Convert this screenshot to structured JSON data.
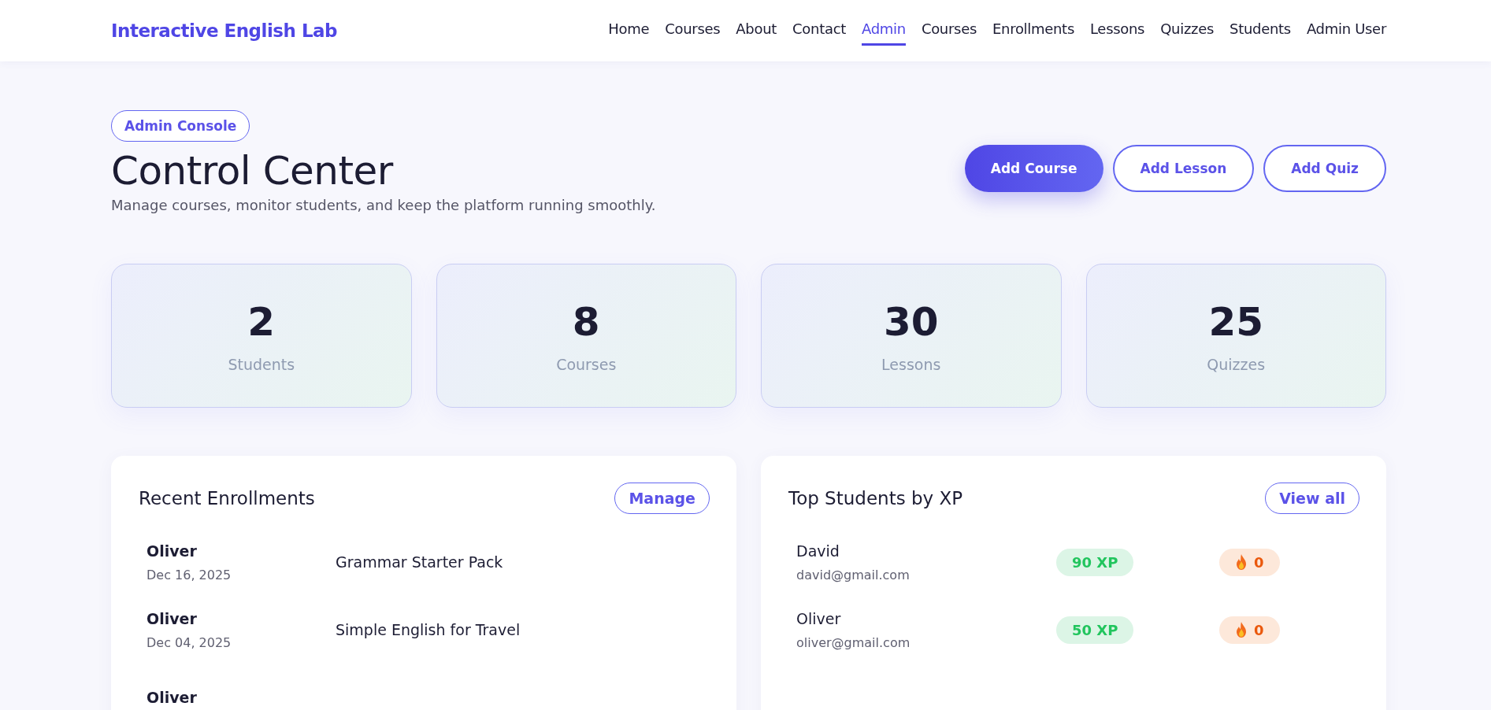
{
  "brand": "Interactive English Lab",
  "nav": [
    {
      "label": "Home",
      "selected": false
    },
    {
      "label": "Courses",
      "selected": false
    },
    {
      "label": "About",
      "selected": false
    },
    {
      "label": "Contact",
      "selected": false
    },
    {
      "label": "Admin",
      "selected": true
    },
    {
      "label": "Courses",
      "selected": false
    },
    {
      "label": "Enrollments",
      "selected": false
    },
    {
      "label": "Lessons",
      "selected": false
    },
    {
      "label": "Quizzes",
      "selected": false
    },
    {
      "label": "Students",
      "selected": false
    },
    {
      "label": "Admin User",
      "selected": false
    }
  ],
  "badge": "Admin Console",
  "title": "Control Center",
  "subtitle": "Manage courses, monitor students, and keep the platform running smoothly.",
  "actions": [
    {
      "label": "Add Course",
      "kind": "primary"
    },
    {
      "label": "Add Lesson",
      "kind": "outline"
    },
    {
      "label": "Add Quiz",
      "kind": "outline"
    }
  ],
  "stats": [
    {
      "value": "2",
      "label": "Students"
    },
    {
      "value": "8",
      "label": "Courses"
    },
    {
      "value": "30",
      "label": "Lessons"
    },
    {
      "value": "25",
      "label": "Quizzes"
    }
  ],
  "enrollments": {
    "title": "Recent Enrollments",
    "button": "Manage",
    "rows": [
      {
        "name": "Oliver",
        "date": "Dec 16, 2025",
        "course": "Grammar Starter Pack"
      },
      {
        "name": "Oliver",
        "date": "Dec 04, 2025",
        "course": "Simple English for Travel"
      },
      {
        "name": "Oliver"
      }
    ]
  },
  "top_students": {
    "title": "Top Students by XP",
    "button": "View all",
    "rows": [
      {
        "name": "David",
        "email": "david@gmail.com",
        "xp": "90 XP",
        "streak": "0"
      },
      {
        "name": "Oliver",
        "email": "oliver@gmail.com",
        "xp": "50 XP",
        "streak": "0"
      }
    ]
  }
}
